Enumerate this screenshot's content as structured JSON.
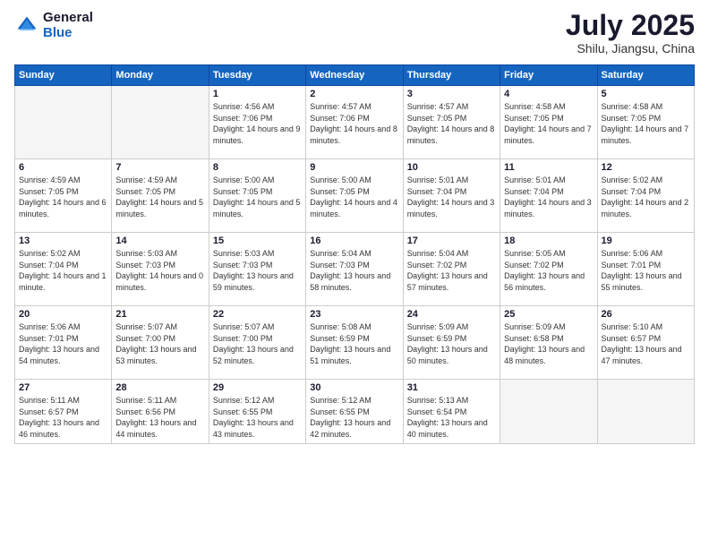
{
  "header": {
    "logo_general": "General",
    "logo_blue": "Blue",
    "month_title": "July 2025",
    "location": "Shilu, Jiangsu, China"
  },
  "weekdays": [
    "Sunday",
    "Monday",
    "Tuesday",
    "Wednesday",
    "Thursday",
    "Friday",
    "Saturday"
  ],
  "weeks": [
    [
      {
        "day": "",
        "empty": true
      },
      {
        "day": "",
        "empty": true
      },
      {
        "day": "1",
        "sunrise": "Sunrise: 4:56 AM",
        "sunset": "Sunset: 7:06 PM",
        "daylight": "Daylight: 14 hours and 9 minutes."
      },
      {
        "day": "2",
        "sunrise": "Sunrise: 4:57 AM",
        "sunset": "Sunset: 7:06 PM",
        "daylight": "Daylight: 14 hours and 8 minutes."
      },
      {
        "day": "3",
        "sunrise": "Sunrise: 4:57 AM",
        "sunset": "Sunset: 7:05 PM",
        "daylight": "Daylight: 14 hours and 8 minutes."
      },
      {
        "day": "4",
        "sunrise": "Sunrise: 4:58 AM",
        "sunset": "Sunset: 7:05 PM",
        "daylight": "Daylight: 14 hours and 7 minutes."
      },
      {
        "day": "5",
        "sunrise": "Sunrise: 4:58 AM",
        "sunset": "Sunset: 7:05 PM",
        "daylight": "Daylight: 14 hours and 7 minutes."
      }
    ],
    [
      {
        "day": "6",
        "sunrise": "Sunrise: 4:59 AM",
        "sunset": "Sunset: 7:05 PM",
        "daylight": "Daylight: 14 hours and 6 minutes."
      },
      {
        "day": "7",
        "sunrise": "Sunrise: 4:59 AM",
        "sunset": "Sunset: 7:05 PM",
        "daylight": "Daylight: 14 hours and 5 minutes."
      },
      {
        "day": "8",
        "sunrise": "Sunrise: 5:00 AM",
        "sunset": "Sunset: 7:05 PM",
        "daylight": "Daylight: 14 hours and 5 minutes."
      },
      {
        "day": "9",
        "sunrise": "Sunrise: 5:00 AM",
        "sunset": "Sunset: 7:05 PM",
        "daylight": "Daylight: 14 hours and 4 minutes."
      },
      {
        "day": "10",
        "sunrise": "Sunrise: 5:01 AM",
        "sunset": "Sunset: 7:04 PM",
        "daylight": "Daylight: 14 hours and 3 minutes."
      },
      {
        "day": "11",
        "sunrise": "Sunrise: 5:01 AM",
        "sunset": "Sunset: 7:04 PM",
        "daylight": "Daylight: 14 hours and 3 minutes."
      },
      {
        "day": "12",
        "sunrise": "Sunrise: 5:02 AM",
        "sunset": "Sunset: 7:04 PM",
        "daylight": "Daylight: 14 hours and 2 minutes."
      }
    ],
    [
      {
        "day": "13",
        "sunrise": "Sunrise: 5:02 AM",
        "sunset": "Sunset: 7:04 PM",
        "daylight": "Daylight: 14 hours and 1 minute."
      },
      {
        "day": "14",
        "sunrise": "Sunrise: 5:03 AM",
        "sunset": "Sunset: 7:03 PM",
        "daylight": "Daylight: 14 hours and 0 minutes."
      },
      {
        "day": "15",
        "sunrise": "Sunrise: 5:03 AM",
        "sunset": "Sunset: 7:03 PM",
        "daylight": "Daylight: 13 hours and 59 minutes."
      },
      {
        "day": "16",
        "sunrise": "Sunrise: 5:04 AM",
        "sunset": "Sunset: 7:03 PM",
        "daylight": "Daylight: 13 hours and 58 minutes."
      },
      {
        "day": "17",
        "sunrise": "Sunrise: 5:04 AM",
        "sunset": "Sunset: 7:02 PM",
        "daylight": "Daylight: 13 hours and 57 minutes."
      },
      {
        "day": "18",
        "sunrise": "Sunrise: 5:05 AM",
        "sunset": "Sunset: 7:02 PM",
        "daylight": "Daylight: 13 hours and 56 minutes."
      },
      {
        "day": "19",
        "sunrise": "Sunrise: 5:06 AM",
        "sunset": "Sunset: 7:01 PM",
        "daylight": "Daylight: 13 hours and 55 minutes."
      }
    ],
    [
      {
        "day": "20",
        "sunrise": "Sunrise: 5:06 AM",
        "sunset": "Sunset: 7:01 PM",
        "daylight": "Daylight: 13 hours and 54 minutes."
      },
      {
        "day": "21",
        "sunrise": "Sunrise: 5:07 AM",
        "sunset": "Sunset: 7:00 PM",
        "daylight": "Daylight: 13 hours and 53 minutes."
      },
      {
        "day": "22",
        "sunrise": "Sunrise: 5:07 AM",
        "sunset": "Sunset: 7:00 PM",
        "daylight": "Daylight: 13 hours and 52 minutes."
      },
      {
        "day": "23",
        "sunrise": "Sunrise: 5:08 AM",
        "sunset": "Sunset: 6:59 PM",
        "daylight": "Daylight: 13 hours and 51 minutes."
      },
      {
        "day": "24",
        "sunrise": "Sunrise: 5:09 AM",
        "sunset": "Sunset: 6:59 PM",
        "daylight": "Daylight: 13 hours and 50 minutes."
      },
      {
        "day": "25",
        "sunrise": "Sunrise: 5:09 AM",
        "sunset": "Sunset: 6:58 PM",
        "daylight": "Daylight: 13 hours and 48 minutes."
      },
      {
        "day": "26",
        "sunrise": "Sunrise: 5:10 AM",
        "sunset": "Sunset: 6:57 PM",
        "daylight": "Daylight: 13 hours and 47 minutes."
      }
    ],
    [
      {
        "day": "27",
        "sunrise": "Sunrise: 5:11 AM",
        "sunset": "Sunset: 6:57 PM",
        "daylight": "Daylight: 13 hours and 46 minutes."
      },
      {
        "day": "28",
        "sunrise": "Sunrise: 5:11 AM",
        "sunset": "Sunset: 6:56 PM",
        "daylight": "Daylight: 13 hours and 44 minutes."
      },
      {
        "day": "29",
        "sunrise": "Sunrise: 5:12 AM",
        "sunset": "Sunset: 6:55 PM",
        "daylight": "Daylight: 13 hours and 43 minutes."
      },
      {
        "day": "30",
        "sunrise": "Sunrise: 5:12 AM",
        "sunset": "Sunset: 6:55 PM",
        "daylight": "Daylight: 13 hours and 42 minutes."
      },
      {
        "day": "31",
        "sunrise": "Sunrise: 5:13 AM",
        "sunset": "Sunset: 6:54 PM",
        "daylight": "Daylight: 13 hours and 40 minutes."
      },
      {
        "day": "",
        "empty": true
      },
      {
        "day": "",
        "empty": true
      }
    ]
  ]
}
